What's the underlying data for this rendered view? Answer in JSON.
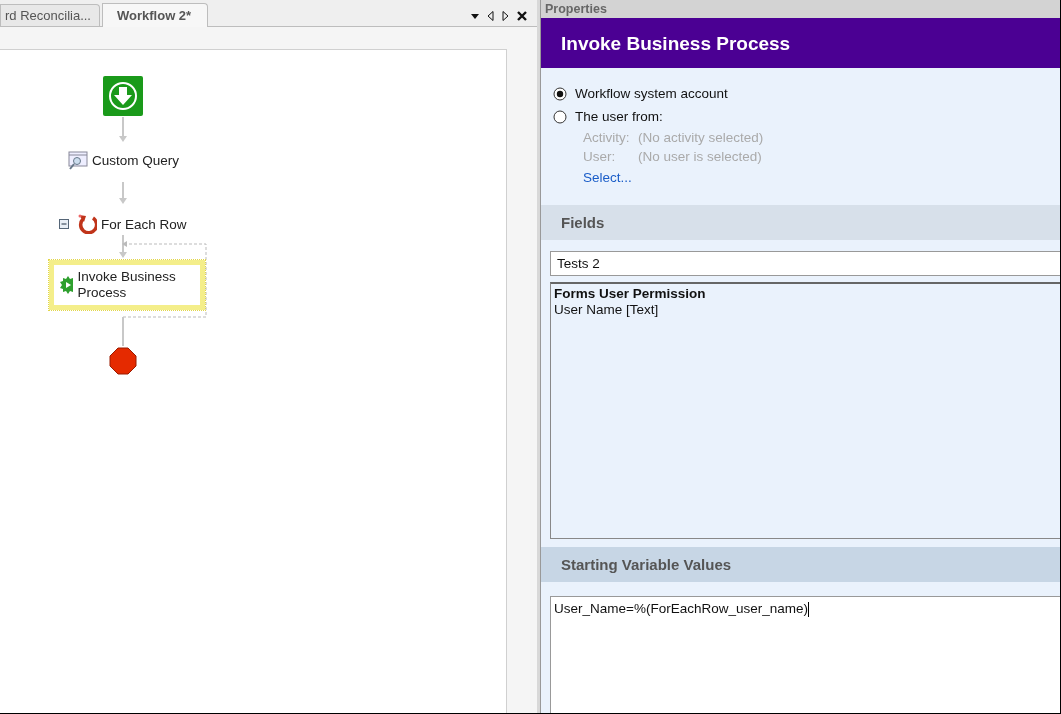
{
  "tabs": [
    {
      "label": "rd Reconcilia...",
      "selected": false
    },
    {
      "label": "Workflow 2*",
      "selected": true
    }
  ],
  "workflow": {
    "nodes": [
      {
        "kind": "start"
      },
      {
        "kind": "activity",
        "label": "Custom Query"
      },
      {
        "kind": "loop",
        "label": "For Each Row",
        "expanded": true
      },
      {
        "kind": "invoke",
        "label": "Invoke Business Process",
        "selected": true
      },
      {
        "kind": "end"
      }
    ]
  },
  "properties": {
    "panel_title": "Properties",
    "title": "Invoke Business Process",
    "run_as": [
      {
        "label": "Workflow system account",
        "selected": true
      },
      {
        "label": "The user from:",
        "selected": false
      }
    ],
    "details": [
      {
        "label": "Activity:",
        "value": "(No activity selected)"
      },
      {
        "label": "User:",
        "value": "(No user is selected)"
      }
    ],
    "select_link": "Select...",
    "fields": {
      "header": "Fields",
      "process": "Tests 2",
      "list": [
        {
          "kind": "heading",
          "text": "Forms User Permission"
        },
        {
          "kind": "item",
          "text": "User Name [Text]"
        }
      ]
    },
    "starting_variables": {
      "header": "Starting Variable Values",
      "value": "User_Name=%(ForEachRow_user_name)"
    }
  }
}
